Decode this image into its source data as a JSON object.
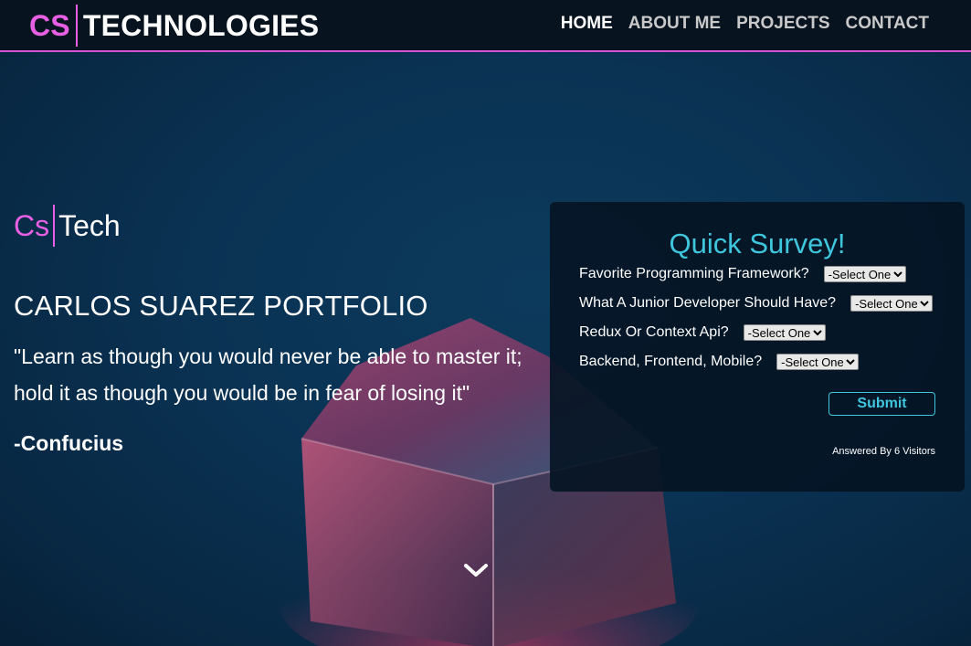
{
  "colors": {
    "accent_pink": "#e75fe2",
    "accent_cyan": "#3fc6dd",
    "background": "#0a3253",
    "nav_bg": "#071420"
  },
  "header": {
    "brand_cs": "CS",
    "brand_tech": "TECHNOLOGIES",
    "nav": [
      {
        "label": "HOME",
        "active": true
      },
      {
        "label": "ABOUT ME",
        "active": false
      },
      {
        "label": "PROJECTS",
        "active": false
      },
      {
        "label": "CONTACT",
        "active": false
      }
    ]
  },
  "hero": {
    "logo_cs": "Cs",
    "logo_tech": "Tech",
    "title": "CARLOS SUAREZ PORTFOLIO",
    "quote": "\"Learn as though you would never be able to master it; hold it as though you would be in fear of losing it\"",
    "author": "-Confucius",
    "scroll_icon": "chevron-down-icon"
  },
  "survey": {
    "title": "Quick Survey!",
    "questions": [
      {
        "label": "Favorite Programming Framework?",
        "selected": "-Select One-"
      },
      {
        "label": "What A Junior Developer Should Have?",
        "selected": "-Select One-"
      },
      {
        "label": "Redux Or Context Api?",
        "selected": "-Select One-"
      },
      {
        "label": "Backend, Frontend, Mobile?",
        "selected": "-Select One-"
      }
    ],
    "submit_label": "Submit",
    "answered_text": "Answered By 6 Visitors"
  }
}
